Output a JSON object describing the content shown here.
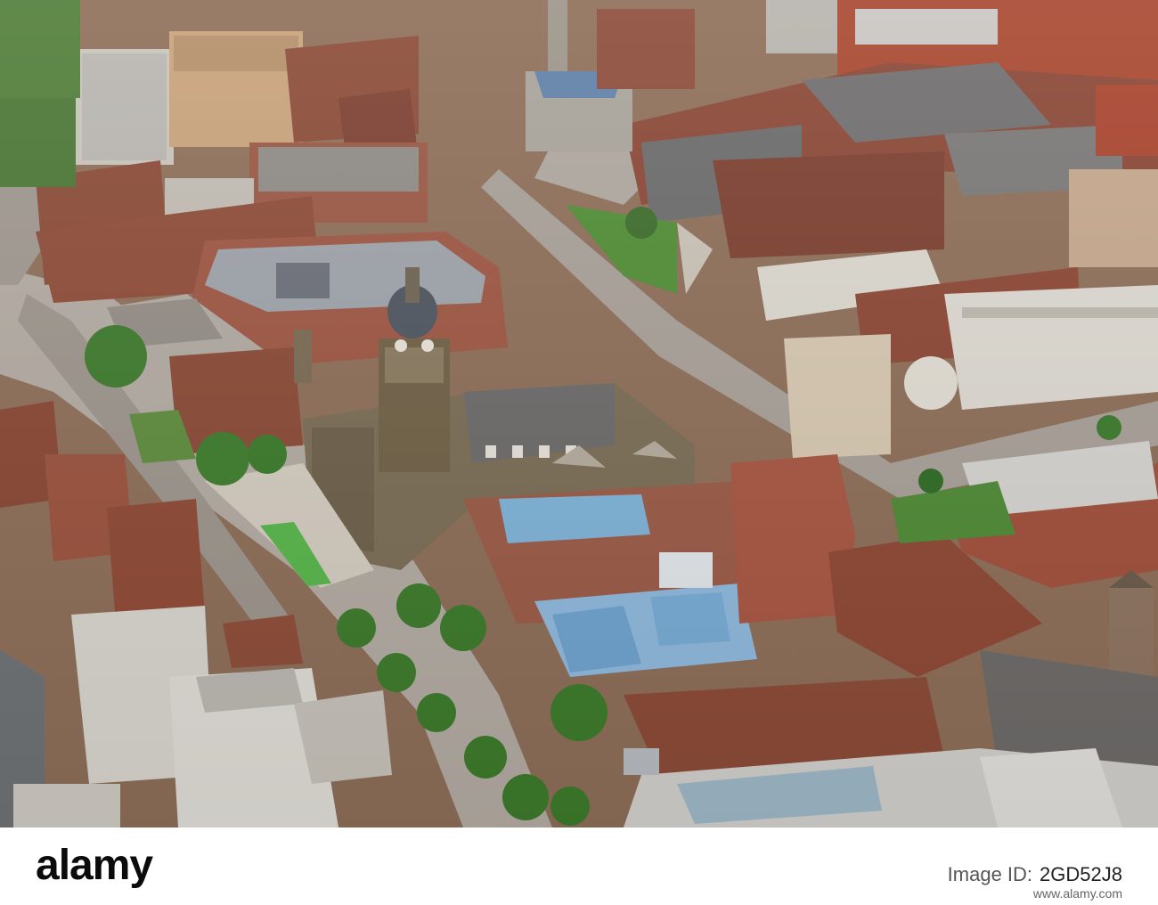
{
  "footer": {
    "brand": "alamy",
    "image_id_label": "Image ID:",
    "image_id": "2GD52J8",
    "site": "www.alamy.com"
  },
  "photo": {
    "subject": "aerial-city-centre",
    "palette": {
      "brick": "#8b4a36",
      "brick_dark": "#6e3527",
      "stone": "#7d6f58",
      "roof_grey": "#6f6f72",
      "glass_blue": "#7fb3d8",
      "tree": "#3f7a2e",
      "lawn": "#5fae3f",
      "road": "#a9a29a",
      "pavement": "#c8bfb2"
    }
  }
}
